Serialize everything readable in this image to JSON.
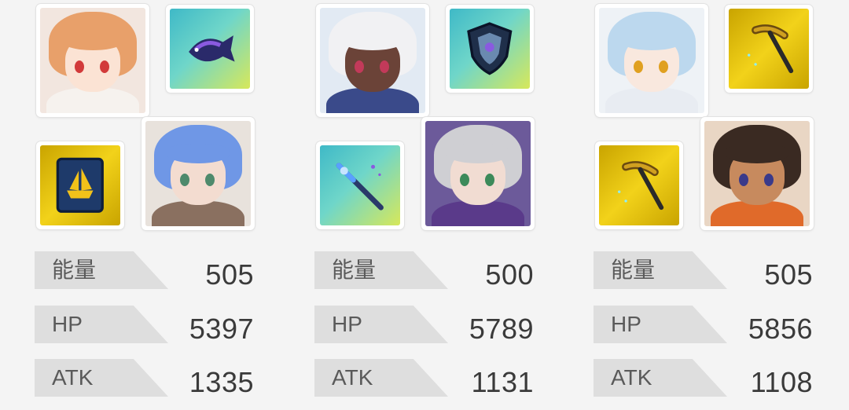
{
  "teams": [
    {
      "characters": [
        {
          "name_icon": "orange-haired-girl-portrait",
          "hair": "#e8a06a",
          "skin": "#fbe3d4",
          "eyes": "#d23a3a",
          "outfit": "#f6f2ee",
          "bg": "#f2e6df"
        },
        {
          "name_icon": "blue-haired-boy-portrait",
          "hair": "#6f97e6",
          "skin": "#f3dcd0",
          "eyes": "#4e8a6c",
          "outfit": "#8a7060",
          "bg": "#e8e2dc"
        }
      ],
      "weapons": [
        {
          "name_icon": "fish-weapon-icon",
          "kind": "teal"
        },
        {
          "name_icon": "ship-tome-icon",
          "kind": "gold"
        }
      ],
      "stats": [
        {
          "label": "能量",
          "value": "505"
        },
        {
          "label": "HP",
          "value": "5397"
        },
        {
          "label": "ATK",
          "value": "1335"
        }
      ]
    },
    {
      "characters": [
        {
          "name_icon": "white-haired-dark-skinned-portrait",
          "hair": "#f1f1f3",
          "skin": "#6b4338",
          "eyes": "#c23a5a",
          "outfit": "#3a4a8a",
          "bg": "#e2eaf3"
        },
        {
          "name_icon": "silver-haired-portrait",
          "hair": "#cfcfd3",
          "skin": "#f1dcd2",
          "eyes": "#3c8a5a",
          "outfit": "#5a3a8a",
          "bg": "#6c5a9a"
        }
      ],
      "weapons": [
        {
          "name_icon": "shield-weapon-icon",
          "kind": "teal"
        },
        {
          "name_icon": "staff-weapon-icon",
          "kind": "teal"
        }
      ],
      "stats": [
        {
          "label": "能量",
          "value": "500"
        },
        {
          "label": "HP",
          "value": "5789"
        },
        {
          "label": "ATK",
          "value": "1131"
        }
      ]
    },
    {
      "characters": [
        {
          "name_icon": "light-blue-haired-portrait",
          "hair": "#bcd8ee",
          "skin": "#f9e8de",
          "eyes": "#e0a020",
          "outfit": "#e8ecf2",
          "bg": "#eef2f6"
        },
        {
          "name_icon": "glasses-aviator-portrait",
          "hair": "#3a2a22",
          "skin": "#c78a5e",
          "eyes": "#3a3a8a",
          "outfit": "#e06a2a",
          "bg": "#e9d6c4"
        }
      ],
      "weapons": [
        {
          "name_icon": "pickaxe-weapon-icon",
          "kind": "gold"
        },
        {
          "name_icon": "pickaxe-weapon-icon",
          "kind": "gold"
        }
      ],
      "stats": [
        {
          "label": "能量",
          "value": "505"
        },
        {
          "label": "HP",
          "value": "5856"
        },
        {
          "label": "ATK",
          "value": "1108"
        }
      ]
    }
  ]
}
